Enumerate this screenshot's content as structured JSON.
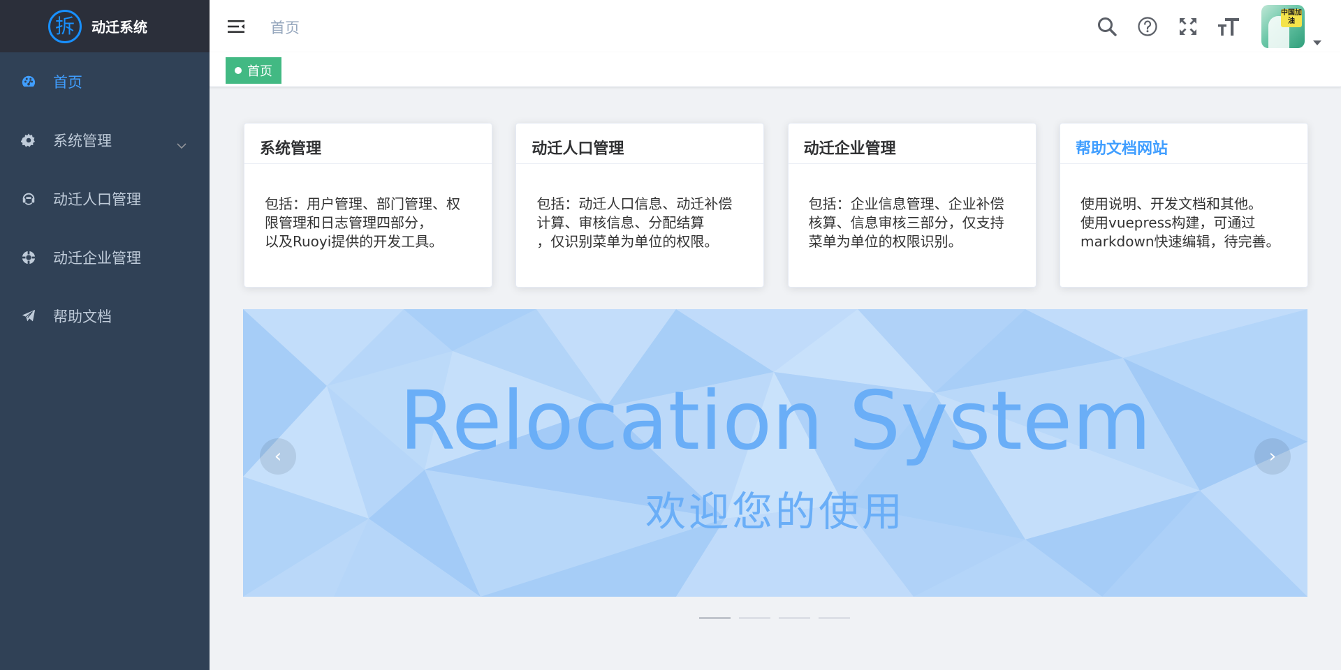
{
  "app": {
    "logo_char": "拆",
    "title": "动迁系统"
  },
  "sidebar": {
    "items": [
      {
        "label": "首页",
        "icon": "dashboard-icon",
        "active": true
      },
      {
        "label": "系统管理",
        "icon": "gear-icon",
        "expandable": true
      },
      {
        "label": "动迁人口管理",
        "icon": "people-icon"
      },
      {
        "label": "动迁企业管理",
        "icon": "enterprise-icon"
      },
      {
        "label": "帮助文档",
        "icon": "paper-plane-icon"
      }
    ]
  },
  "header": {
    "breadcrumb": "首页",
    "icons": [
      "search-icon",
      "question-icon",
      "fullscreen-icon",
      "font-size-icon"
    ],
    "avatar_badge": "中国加油"
  },
  "tags": {
    "active_tag": "首页"
  },
  "cards": [
    {
      "title": "系统管理",
      "is_link": false,
      "body": [
        "包括：用户管理、部门管理、权",
        "限管理和日志管理四部分，",
        "以及Ruoyi提供的开发工具。"
      ]
    },
    {
      "title": "动迁人口管理",
      "is_link": false,
      "body": [
        "包括：动迁人口信息、动迁补偿",
        "计算、审核信息、分配结算",
        "，仅识别菜单为单位的权限。"
      ]
    },
    {
      "title": "动迁企业管理",
      "is_link": false,
      "body": [
        "包括：企业信息管理、企业补偿",
        "核算、信息审核三部分，仅支持",
        "菜单为单位的权限识别。"
      ]
    },
    {
      "title": "帮助文档网站",
      "is_link": true,
      "body": [
        "使用说明、开发文档和其他。",
        "使用vuepress构建，可通过",
        "markdown快速编辑，待完善。"
      ]
    }
  ],
  "carousel": {
    "title": "Relocation System",
    "subtitle": "欢迎您的使用",
    "prev_glyph": "‹",
    "next_glyph": "›",
    "indicator_count": 4,
    "active_index": 0
  },
  "colors": {
    "sidebar_bg": "#304156",
    "logo_bg": "#2b2f3a",
    "accent": "#409eff",
    "tag_green": "#42b983",
    "slide_text": "#6aaef7"
  }
}
